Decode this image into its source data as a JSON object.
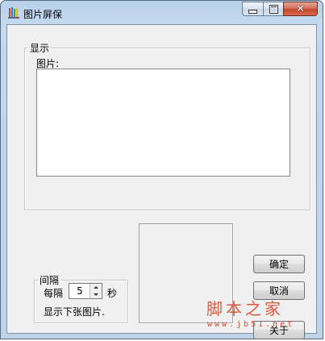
{
  "window": {
    "title": "图片屏保",
    "icon": "screensaver-pencils-icon",
    "close_glyph": "✕"
  },
  "display_group": {
    "legend": "显示",
    "picture_label": "图片:",
    "pictures": []
  },
  "interval_group": {
    "legend": "间隔",
    "every_label": "每隔",
    "seconds_value": "5",
    "seconds_unit": "秒",
    "next_picture_label": "显示下张图片."
  },
  "buttons": {
    "ok": "确定",
    "cancel": "取消",
    "about": "关于"
  },
  "watermark": {
    "text": "脚本之家",
    "url": "www.jb51.net"
  },
  "colors": {
    "title_bar": "#c3d7ec",
    "client_bg": "#f0f0f0",
    "close_button": "#c7462c",
    "watermark": "#d84a2c"
  }
}
